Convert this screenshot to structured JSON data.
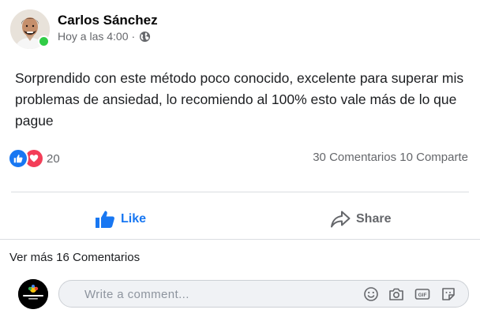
{
  "post": {
    "author": "Carlos Sánchez",
    "timestamp": "Hoy a las 4:00",
    "separator": "·",
    "privacy_icon": "globe-icon",
    "online": true,
    "text": "Sorprendido con este método poco conocido, excelente para superar mis problemas de ansiedad, lo recomiendo al 100% esto vale más de lo que pague"
  },
  "stats": {
    "reactions": [
      "like",
      "love"
    ],
    "reaction_count": "20",
    "comments": "30 Comentarios",
    "shares": "10 Comparte"
  },
  "actions": {
    "like_label": "Like",
    "share_label": "Share"
  },
  "comments": {
    "view_more": "Ver más 16 Comentarios",
    "placeholder": "Write a comment...",
    "input_icons": [
      "emoji-icon",
      "camera-icon",
      "gif-icon",
      "sticker-icon"
    ]
  },
  "colors": {
    "brand_blue": "#1877f2",
    "love_red": "#f33e58",
    "online_green": "#31cc46",
    "secondary_text": "#65676b"
  }
}
